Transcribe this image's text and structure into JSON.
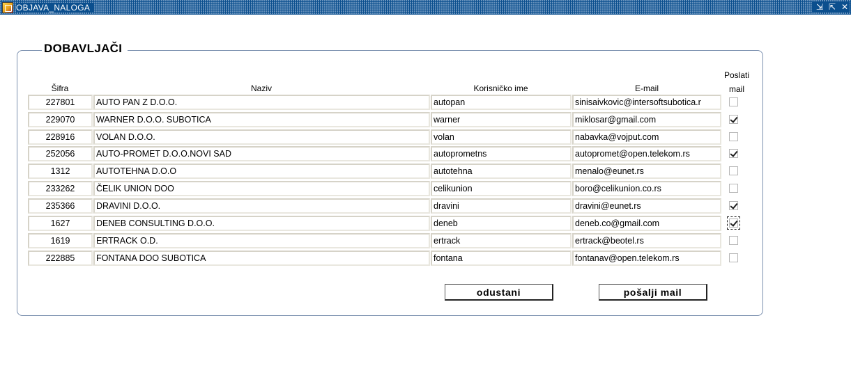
{
  "window": {
    "title": "OBJAVA_NALOGA",
    "controls": [
      "⇲",
      "⇱",
      "✕"
    ]
  },
  "frame": {
    "title": "DOBAVLJAČI"
  },
  "table": {
    "headers": {
      "sifra": "Šifra",
      "naziv": "Naziv",
      "korisnicko_ime": "Korisničko ime",
      "email": "E-mail",
      "poslati_mail": "Poslati mail"
    },
    "rows": [
      {
        "sifra": "227801",
        "naziv": "AUTO PAN Z  D.O.O.",
        "korisnicko_ime": "autopan",
        "email": "sinisaivkovic@intersoftsubotica.r",
        "poslati": false
      },
      {
        "sifra": "229070",
        "naziv": "WARNER D.O.O. SUBOTICA",
        "korisnicko_ime": "warner",
        "email": "miklosar@gmail.com",
        "poslati": true
      },
      {
        "sifra": "228916",
        "naziv": "VOLAN D.O.O.",
        "korisnicko_ime": "volan",
        "email": "nabavka@vojput.com",
        "poslati": false
      },
      {
        "sifra": "252056",
        "naziv": "AUTO-PROMET D.O.O.NOVI SAD",
        "korisnicko_ime": "autoprometns",
        "email": "autopromet@open.telekom.rs",
        "poslati": true
      },
      {
        "sifra": "1312",
        "naziv": "AUTOTEHNA D.O.O",
        "korisnicko_ime": "autotehna",
        "email": "menalo@eunet.rs",
        "poslati": false
      },
      {
        "sifra": "233262",
        "naziv": "ČELIK UNION DOO",
        "korisnicko_ime": "celikunion",
        "email": "boro@celikunion.co.rs",
        "poslati": false
      },
      {
        "sifra": "235366",
        "naziv": "DRAVINI  D.O.O.",
        "korisnicko_ime": "dravini",
        "email": "dravini@eunet.rs",
        "poslati": true
      },
      {
        "sifra": "1627",
        "naziv": "DENEB CONSULTING D.O.O.",
        "korisnicko_ime": "deneb",
        "email": "deneb.co@gmail.com",
        "poslati": true,
        "focused": true
      },
      {
        "sifra": "1619",
        "naziv": "ERTRACK O.D.",
        "korisnicko_ime": "ertrack",
        "email": "ertrack@beotel.rs",
        "poslati": false
      },
      {
        "sifra": "222885",
        "naziv": "FONTANA DOO SUBOTICA",
        "korisnicko_ime": "fontana",
        "email": "fontanav@open.telekom.rs",
        "poslati": false
      }
    ]
  },
  "buttons": {
    "odustani": "odustani",
    "posalji": "pošalji mail"
  }
}
